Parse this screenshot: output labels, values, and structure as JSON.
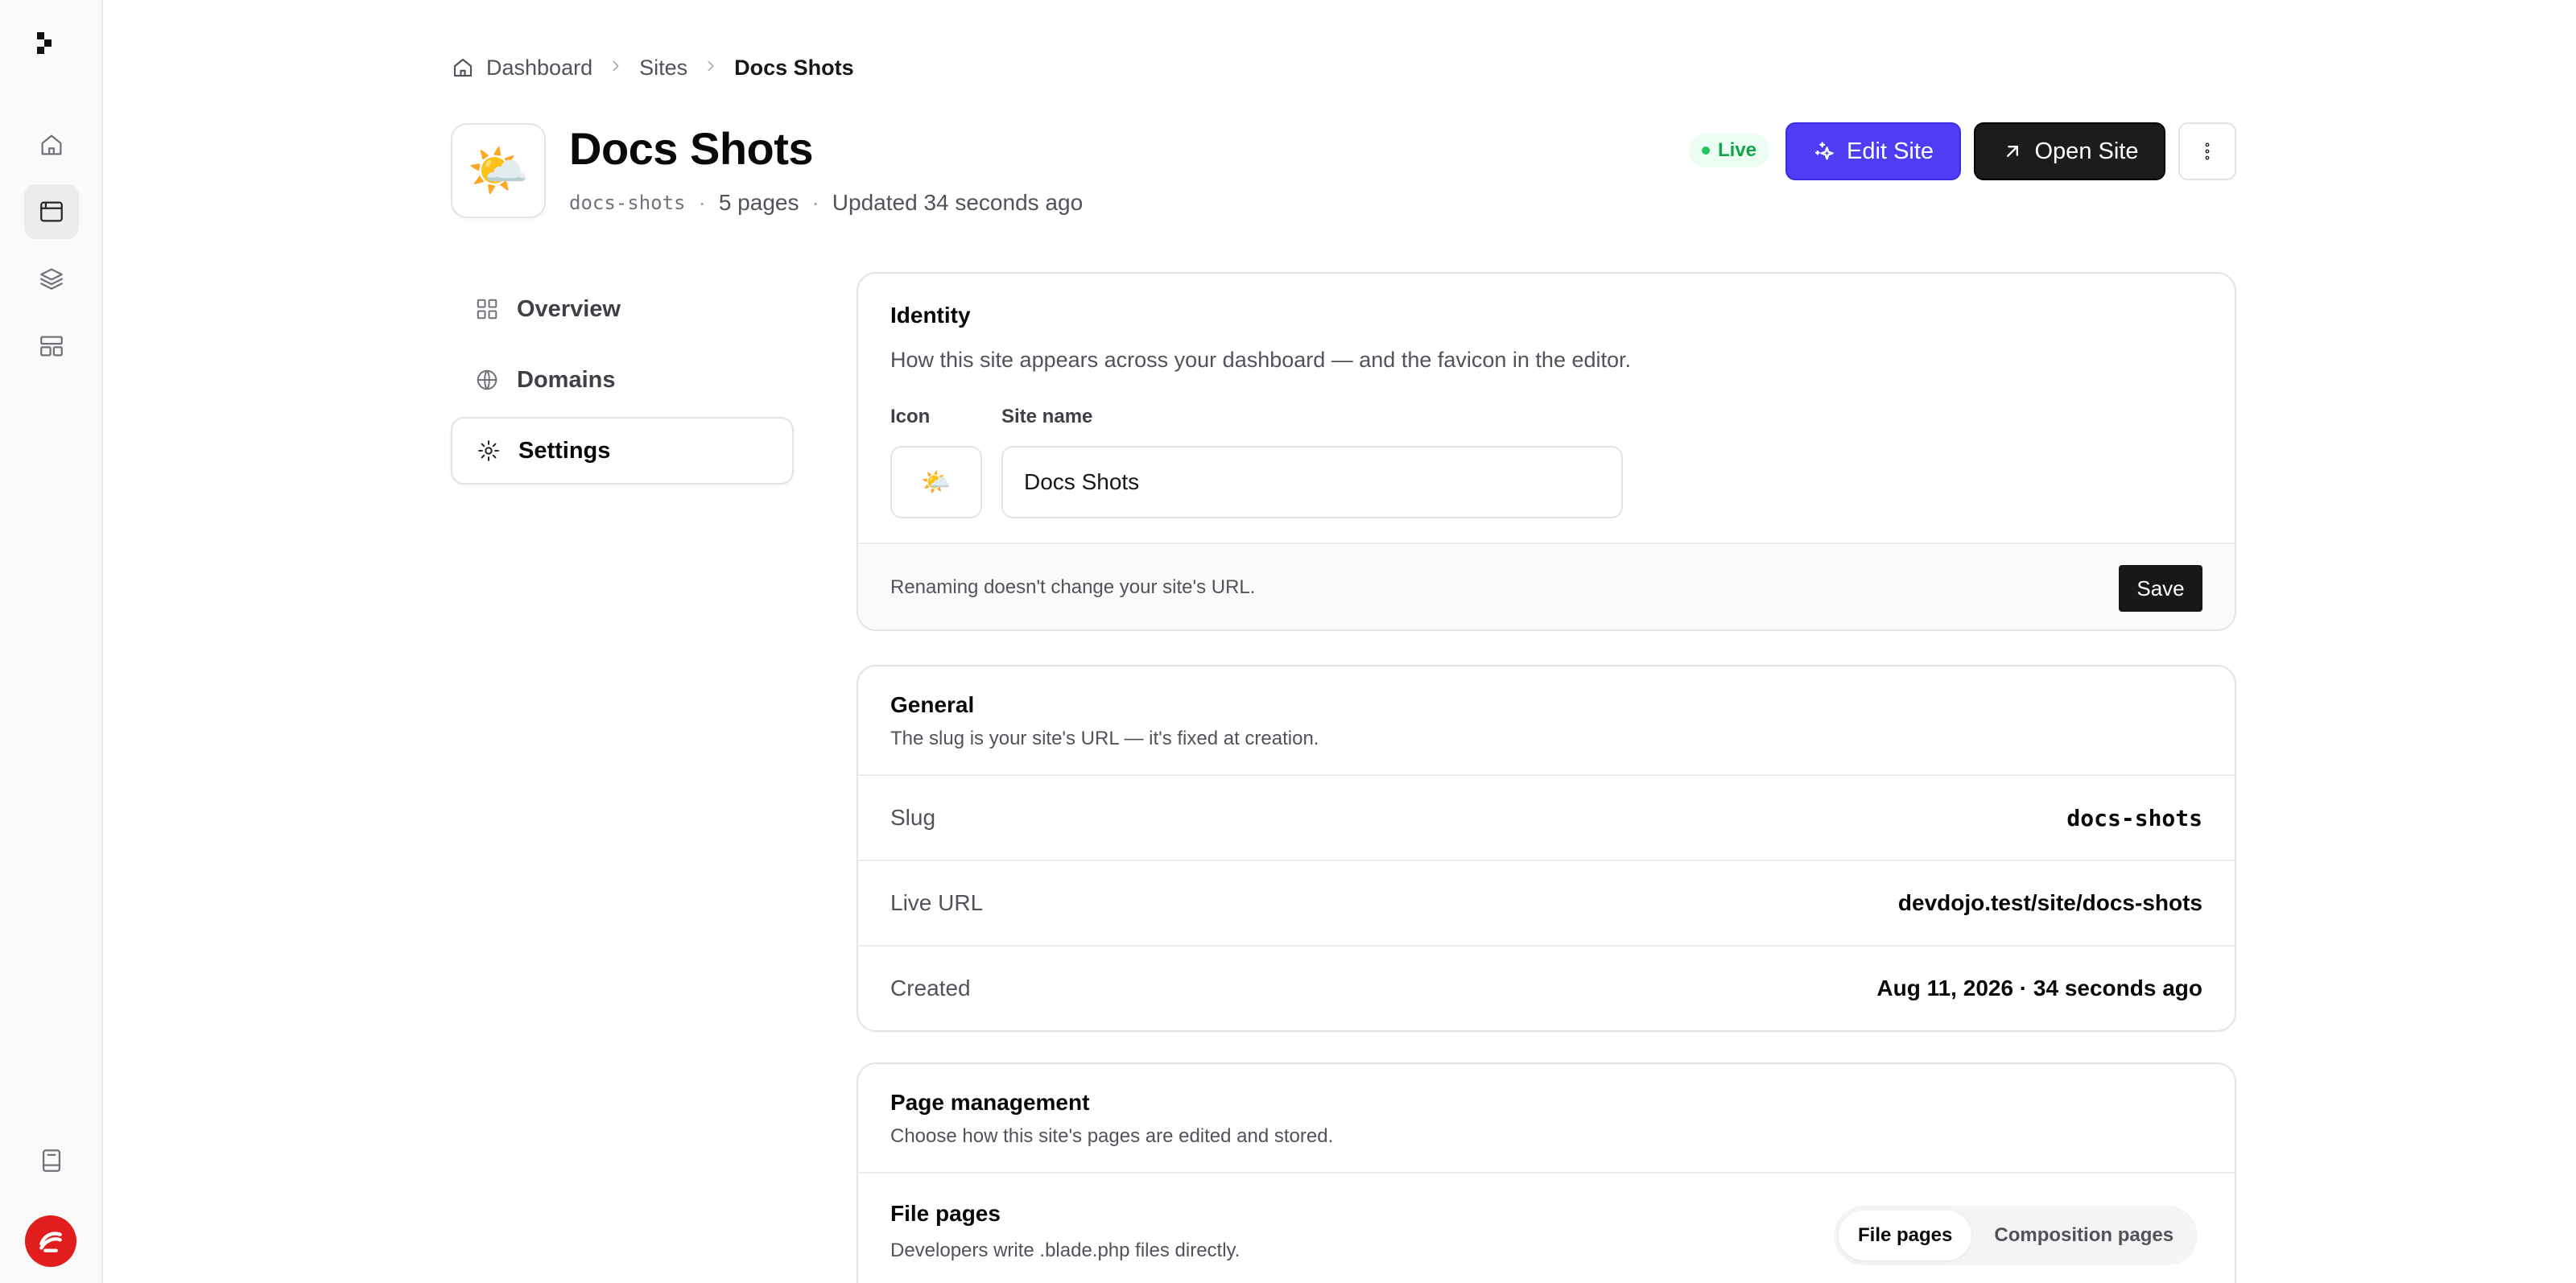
{
  "breadcrumb": {
    "items": [
      "Dashboard",
      "Sites"
    ],
    "current": "Docs Shots"
  },
  "site": {
    "icon": "🌤️",
    "title": "Docs Shots",
    "slug": "docs-shots",
    "pages": "5 pages",
    "updated": "Updated 34 seconds ago",
    "separator": "·",
    "status": "Live"
  },
  "actions": {
    "edit_label": "Edit Site",
    "open_label": "Open Site"
  },
  "nav": {
    "items": [
      "Overview",
      "Domains",
      "Settings"
    ],
    "active": "Settings"
  },
  "identity": {
    "title": "Identity",
    "description": "How this site appears across your dashboard — and the favicon in the editor.",
    "icon_label": "Icon",
    "icon_value": "🌤️",
    "name_label": "Site name",
    "name_value": "Docs Shots",
    "footer_note": "Renaming doesn't change your site's URL.",
    "save_label": "Save"
  },
  "general": {
    "title": "General",
    "description": "The slug is your site's URL — it's fixed at creation.",
    "rows": [
      {
        "label": "Slug",
        "value": "docs-shots"
      },
      {
        "label": "Live URL",
        "value": "devdojo.test/site/docs-shots"
      },
      {
        "label": "Created",
        "value": "Aug 11, 2026 · 34 seconds ago"
      }
    ]
  },
  "page_management": {
    "title": "Page management",
    "description": "Choose how this site's pages are edited and stored.",
    "mode_title": "File pages",
    "mode_description": "Developers write .blade.php files directly.",
    "options": [
      "File pages",
      "Composition pages"
    ],
    "selected": "File pages"
  },
  "colors": {
    "accent": "#4f3df5",
    "live": "#16a34a",
    "brand": "#e11d1d"
  }
}
